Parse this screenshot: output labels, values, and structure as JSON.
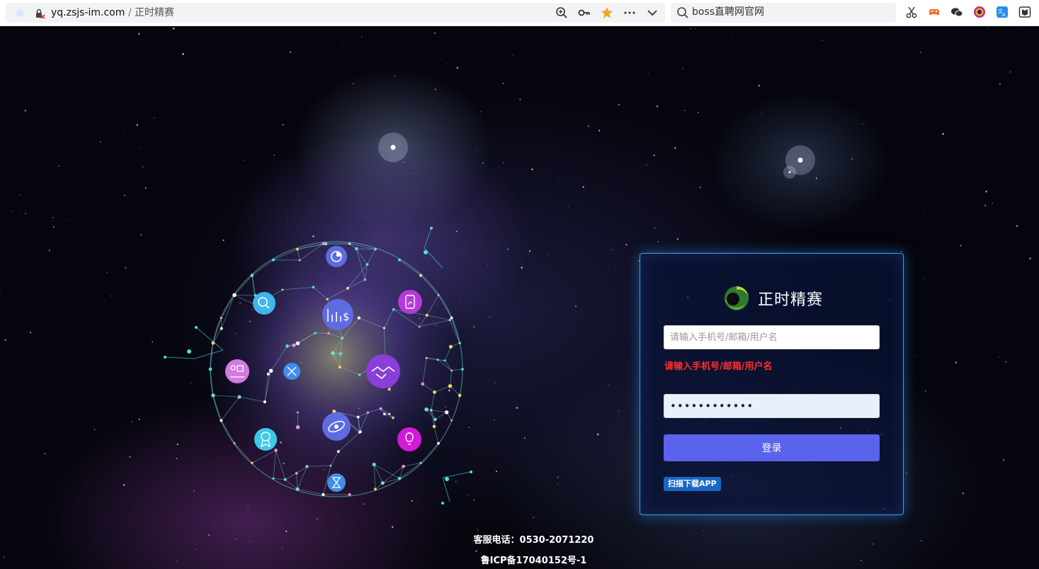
{
  "browser": {
    "address": {
      "domain": "yq.zsjs-im.com",
      "separator": " / ",
      "title": "正时精赛"
    },
    "search": {
      "value": "boss直聘网官网"
    },
    "icons": [
      "zoom-icon",
      "key-icon",
      "star-icon",
      "more-icon",
      "chevron-down-icon"
    ],
    "extensions": [
      "scissors-icon",
      "game-icon",
      "wechat-icon",
      "camera-icon",
      "translate-icon",
      "reader-icon"
    ]
  },
  "login": {
    "brand": "正时精赛",
    "username_placeholder": "请输入手机号/邮箱/用户名",
    "username_value": "",
    "error": "请输入手机号/邮箱/用户名",
    "password_value": "••••••••••••",
    "submit_label": "登录",
    "app_label": "扫描下载APP"
  },
  "footer": {
    "service": "客服电话：0530-2071220",
    "icp": "鲁ICP备17040152号-1"
  },
  "colors": {
    "accent": "#5a63ec",
    "error": "#ff2d2d",
    "card_border": "#3aa0e6",
    "app_button": "#1768c4"
  }
}
